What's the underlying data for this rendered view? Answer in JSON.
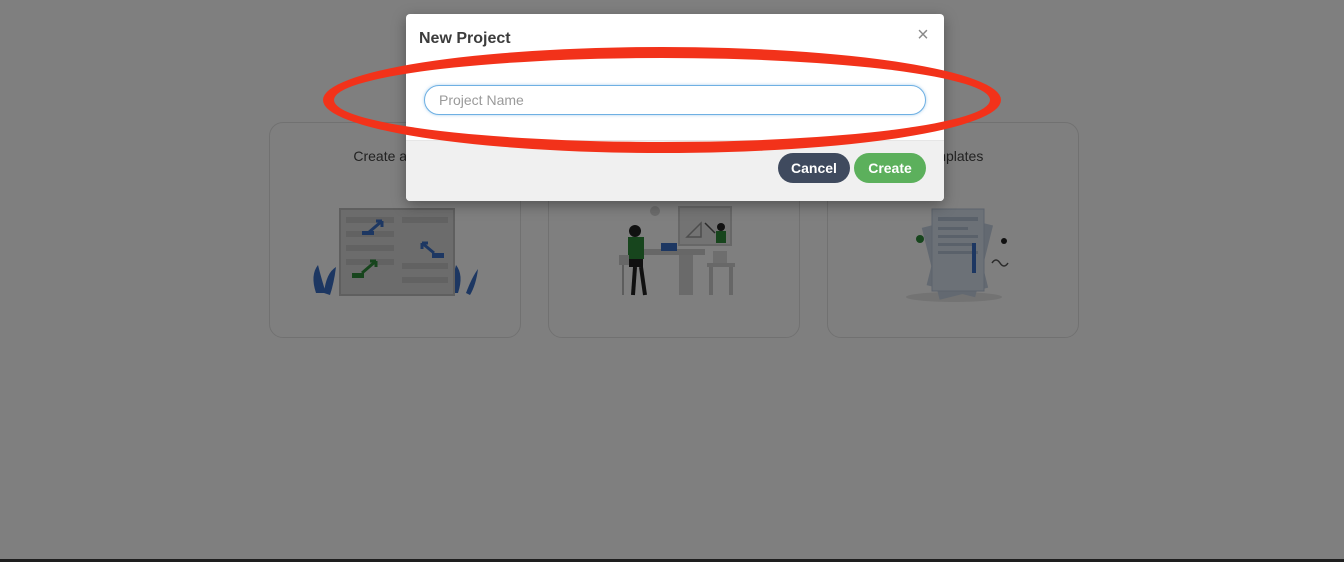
{
  "cards": [
    {
      "label": "Create a new"
    },
    {
      "label": ""
    },
    {
      "label": "templates"
    }
  ],
  "modal": {
    "title": "New Project",
    "close_icon": "×",
    "name_input": {
      "placeholder": "Project Name",
      "value": ""
    },
    "buttons": {
      "cancel_label": "Cancel",
      "create_label": "Create"
    }
  },
  "colors": {
    "cancel": "#3f4a5e",
    "create": "#5cb05c",
    "highlight": "#f2321a",
    "input_focus": "#6fb0e3",
    "illustration_green": "#2e8b3a",
    "illustration_blue": "#3a6fc4"
  }
}
